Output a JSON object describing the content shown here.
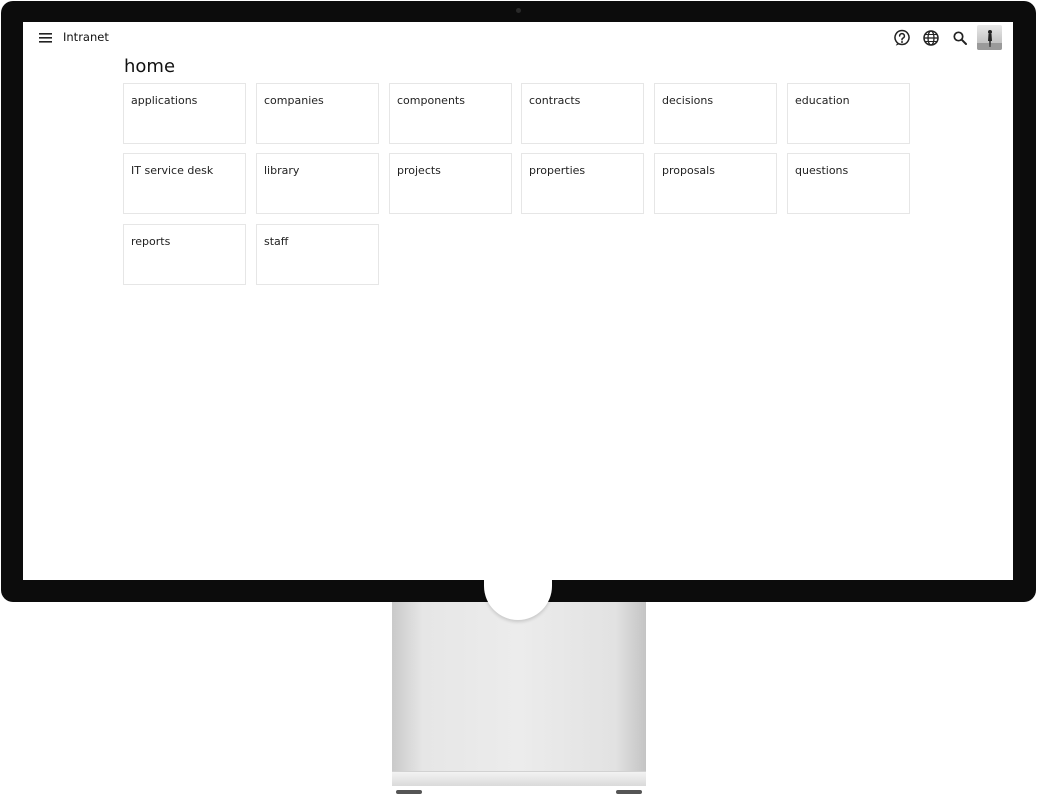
{
  "app": {
    "title": "Intranet"
  },
  "toolbar": {
    "menu_icon": "hamburger-menu-icon",
    "help_icon": "help-circle-icon",
    "language_icon": "globe-icon",
    "search_icon": "search-icon",
    "avatar": "user-avatar"
  },
  "page": {
    "title": "home"
  },
  "tiles": [
    {
      "label": "applications"
    },
    {
      "label": "companies"
    },
    {
      "label": "components"
    },
    {
      "label": "contracts"
    },
    {
      "label": "decisions"
    },
    {
      "label": "education"
    },
    {
      "label": "IT service desk"
    },
    {
      "label": "library"
    },
    {
      "label": "projects"
    },
    {
      "label": "properties"
    },
    {
      "label": "proposals"
    },
    {
      "label": "questions"
    },
    {
      "label": "reports"
    },
    {
      "label": "staff"
    }
  ],
  "colors": {
    "bezel": "#0c0c0c",
    "tile_border": "#e6e6e6",
    "text": "#111111"
  }
}
